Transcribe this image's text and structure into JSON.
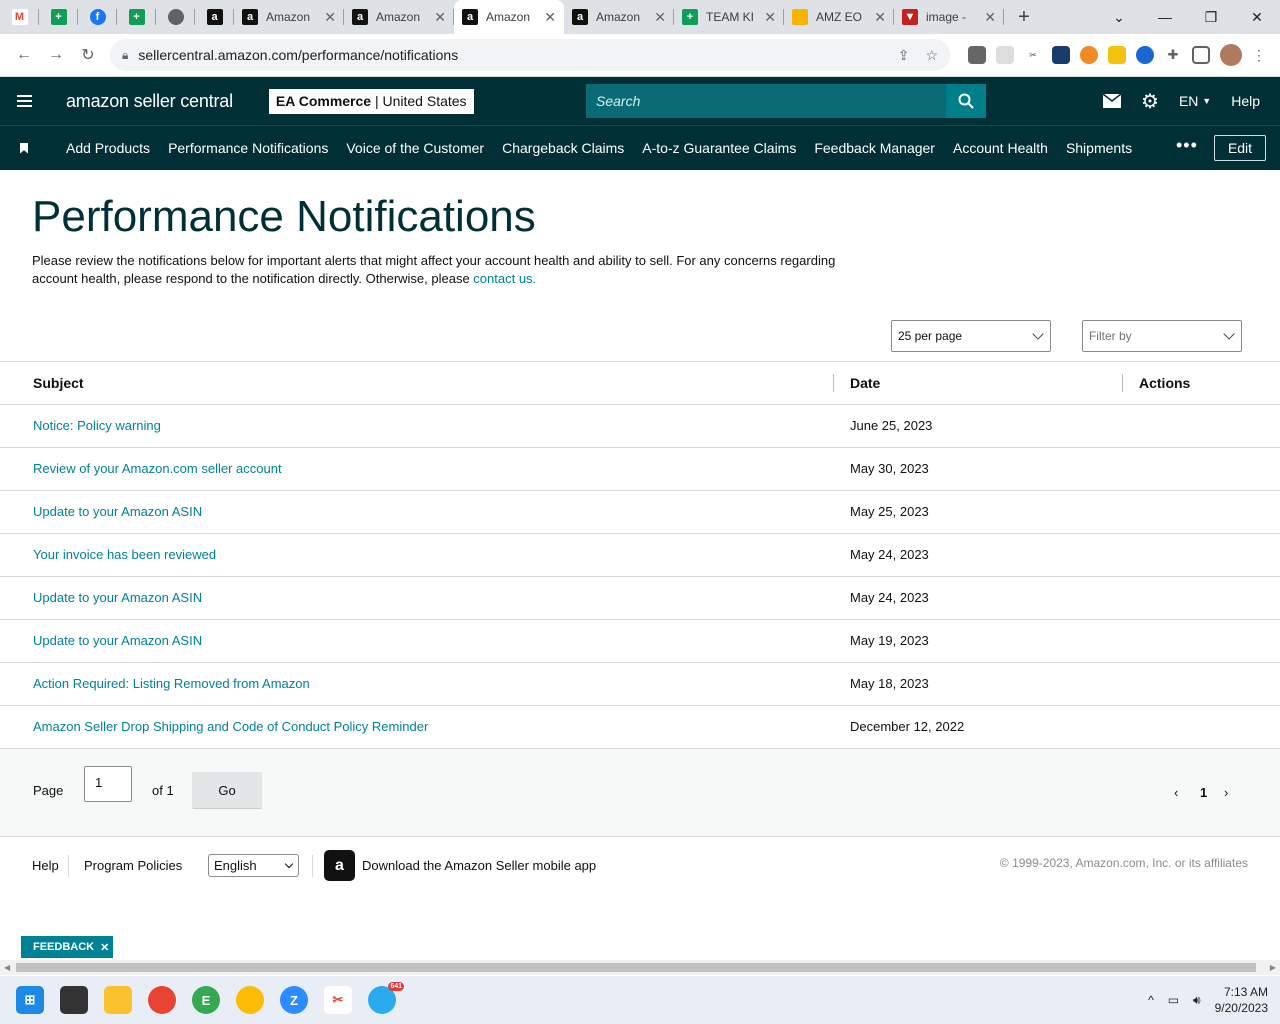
{
  "browser": {
    "tabs": [
      {
        "title": "Amazon",
        "icon": "amazon-icon"
      },
      {
        "title": "Amazon",
        "icon": "amazon-icon"
      },
      {
        "title": "Amazon",
        "icon": "amazon-icon",
        "active": true
      },
      {
        "title": "Amazon",
        "icon": "amazon-icon"
      },
      {
        "title": "TEAM KI",
        "icon": "sheets-icon"
      },
      {
        "title": "AMZ EO",
        "icon": "extension-icon"
      },
      {
        "title": "image -",
        "icon": "triangle-icon"
      }
    ],
    "url": "sellercentral.amazon.com/performance/notifications"
  },
  "header": {
    "logo": "amazon seller central",
    "store_name": "EA Commerce",
    "store_region": "United States",
    "search_placeholder": "Search",
    "language": "EN",
    "help": "Help"
  },
  "nav": {
    "links": [
      "Add Products",
      "Performance Notifications",
      "Voice of the Customer",
      "Chargeback Claims",
      "A-to-z Guarantee Claims",
      "Feedback Manager",
      "Account Health",
      "Shipments"
    ],
    "more": "•••",
    "edit": "Edit"
  },
  "main": {
    "title": "Performance Notifications",
    "intro": "Please review the notifications below for important alerts that might affect your account health and ability to sell. For any concerns regarding account health, please respond to the notification directly. Otherwise, please ",
    "contact_link": "contact us.",
    "per_page": "25 per page",
    "filter_placeholder": "Filter by",
    "columns": {
      "subject": "Subject",
      "date": "Date",
      "actions": "Actions"
    },
    "rows": [
      {
        "subject": "Notice: Policy warning",
        "date": "June 25, 2023"
      },
      {
        "subject": "Review of your Amazon.com seller account",
        "date": "May 30, 2023"
      },
      {
        "subject": "Update to your Amazon ASIN",
        "date": "May 25, 2023"
      },
      {
        "subject": "Your invoice has been reviewed",
        "date": "May 24, 2023"
      },
      {
        "subject": "Update to your Amazon ASIN",
        "date": "May 24, 2023"
      },
      {
        "subject": "Update to your Amazon ASIN",
        "date": "May 19, 2023"
      },
      {
        "subject": "Action Required: Listing Removed from Amazon",
        "date": "May 18, 2023"
      },
      {
        "subject": "Amazon Seller Drop Shipping and Code of Conduct Policy Reminder",
        "date": "December 12, 2022"
      }
    ]
  },
  "pager": {
    "page_label": "Page",
    "page_value": "1",
    "of_label": "of 1",
    "go": "Go",
    "current": "1"
  },
  "footer": {
    "help": "Help",
    "policies": "Program Policies",
    "language": "English",
    "app_text": "Download the Amazon Seller mobile app",
    "copyright": "© 1999-2023, Amazon.com, Inc. or its affiliates"
  },
  "feedback": "FEEDBACK",
  "taskbar": {
    "time": "7:13 AM",
    "date": "9/20/2023",
    "telegram_badge": "641"
  },
  "colors": {
    "header_bg": "#002f36",
    "link": "#008296",
    "search_btn": "#007e8a"
  }
}
